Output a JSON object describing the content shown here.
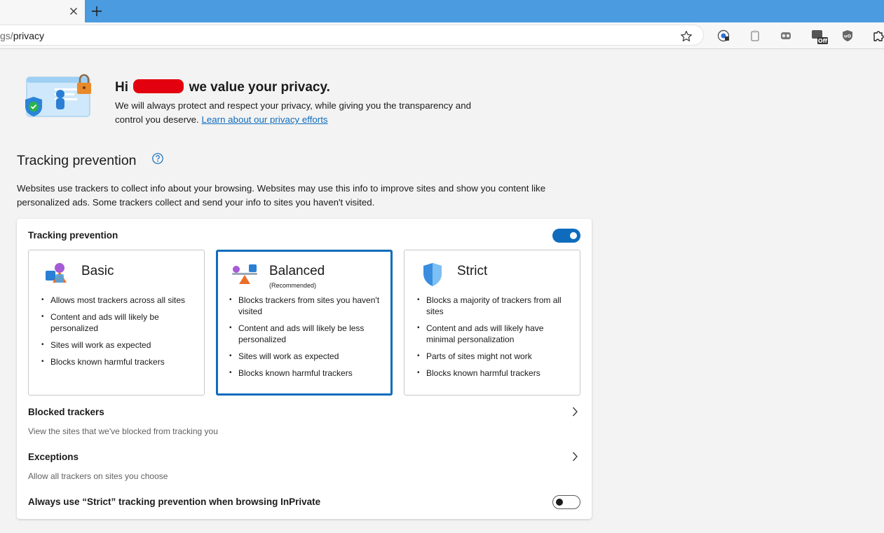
{
  "browser": {
    "url_faded": "gs/",
    "url_path": "privacy"
  },
  "hero": {
    "greeting": "Hi",
    "title_rest": "we value your privacy.",
    "body": "We will always protect and respect your privacy, while giving you the transparency and control you deserve.",
    "link": "Learn about our privacy efforts"
  },
  "tracking": {
    "section_title": "Tracking prevention",
    "description": "Websites use trackers to collect info about your browsing. Websites may use this info to improve sites and show you content like personalized ads. Some trackers collect and send your info to sites you haven't visited.",
    "card_heading": "Tracking prevention",
    "enabled": true,
    "options": [
      {
        "title": "Basic",
        "subtitle": "",
        "bullets": [
          "Allows most trackers across all sites",
          "Content and ads will likely be personalized",
          "Sites will work as expected",
          "Blocks known harmful trackers"
        ]
      },
      {
        "title": "Balanced",
        "subtitle": "(Recommended)",
        "selected": true,
        "bullets": [
          "Blocks trackers from sites you haven't visited",
          "Content and ads will likely be less personalized",
          "Sites will work as expected",
          "Blocks known harmful trackers"
        ]
      },
      {
        "title": "Strict",
        "subtitle": "",
        "bullets": [
          "Blocks a majority of trackers from all sites",
          "Content and ads will likely have minimal personalization",
          "Parts of sites might not work",
          "Blocks known harmful trackers"
        ]
      }
    ],
    "blocked": {
      "title": "Blocked trackers",
      "subtitle": "View the sites that we've blocked from tracking you"
    },
    "exceptions": {
      "title": "Exceptions",
      "subtitle": "Allow all trackers on sites you choose"
    },
    "inprivate": {
      "label": "Always use “Strict” tracking prevention when browsing InPrivate",
      "enabled": false
    }
  },
  "extensions": {
    "off_badge": "Off"
  },
  "colors": {
    "accent": "#0f6cbd",
    "tabstrip": "#4a9be0",
    "page_bg": "#f3f3f3",
    "redaction": "#e3000f"
  }
}
